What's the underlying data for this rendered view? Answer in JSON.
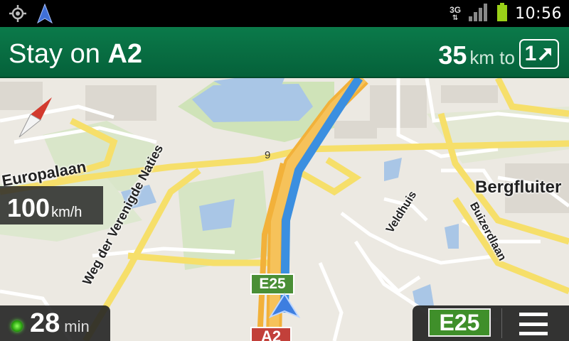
{
  "status_bar": {
    "network_type": "3G",
    "time": "10:56",
    "icons": [
      "gps-icon",
      "navigation-icon",
      "data-transfer-icon",
      "signal-icon",
      "battery-icon"
    ],
    "battery_color": "#9ad118"
  },
  "instruction": {
    "prefix": "Stay on",
    "road": "A2",
    "distance_value": "35",
    "distance_unit": "km to",
    "exit_number": "1",
    "background_color": "#0b7a4a"
  },
  "map": {
    "labels": {
      "europalaan": "Europalaan",
      "weg_verenigde_naties": "Weg der Verenigde Naties",
      "bergfluiter": "Bergfluiter",
      "buizerdlaan": "Buizerdlaan",
      "veldhuis": "Veldhuis",
      "exit_number": "9"
    },
    "route_shields": {
      "e25": "E25",
      "a2": "A2"
    },
    "route_color": "#3b8fe0"
  },
  "speed_limit": {
    "value": "100",
    "unit": "km/h"
  },
  "eta": {
    "value": "28",
    "unit": "min"
  },
  "controls": {
    "road_button_label": "E25",
    "menu_icon": "menu-icon"
  }
}
